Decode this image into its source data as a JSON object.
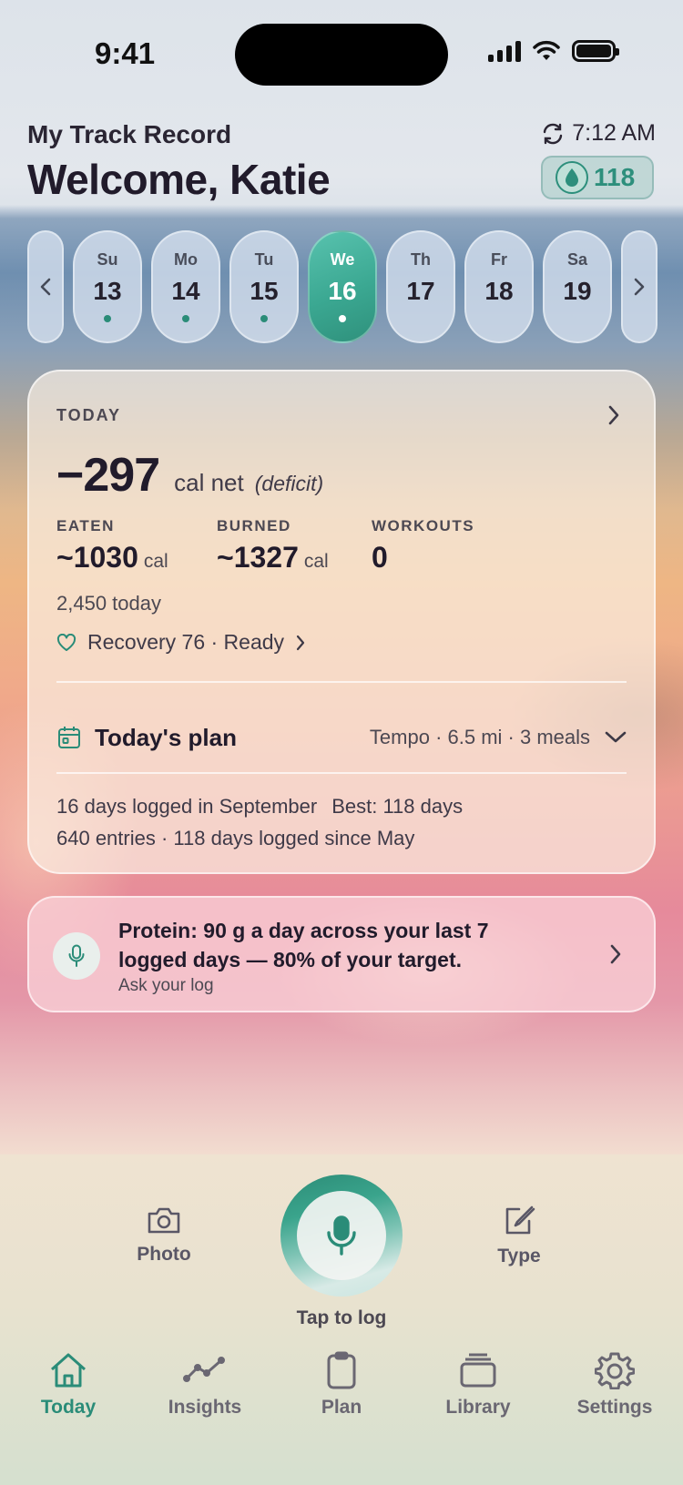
{
  "status_bar": {
    "time": "9:41"
  },
  "header": {
    "subtitle": "My Track Record",
    "title": "Welcome, Katie",
    "sync_time": "7:12 AM",
    "streak_count": "118"
  },
  "day_strip": {
    "days": [
      {
        "name": "Su",
        "date": "13",
        "logged": true,
        "selected": false
      },
      {
        "name": "Mo",
        "date": "14",
        "logged": true,
        "selected": false
      },
      {
        "name": "Tu",
        "date": "15",
        "logged": true,
        "selected": false
      },
      {
        "name": "We",
        "date": "16",
        "logged": true,
        "selected": true
      },
      {
        "name": "Th",
        "date": "17",
        "logged": false,
        "selected": false
      },
      {
        "name": "Fr",
        "date": "18",
        "logged": false,
        "selected": false
      },
      {
        "name": "Sa",
        "date": "19",
        "logged": false,
        "selected": false
      }
    ]
  },
  "summary": {
    "label": "TODAY",
    "net_value": "−297",
    "net_unit": "cal net",
    "net_note": "(deficit)",
    "eaten_label": "EATEN",
    "eaten_value": "~1030",
    "eaten_unit": "cal",
    "burned_label": "BURNED",
    "burned_value": "~1327",
    "burned_unit": "cal",
    "workouts_label": "WORKOUTS",
    "workouts_value": "0",
    "daily_total": "2,450 today",
    "recovery": "Recovery 76 · Ready",
    "plan_title": "Today's plan",
    "plan_summary": "Tempo · 6.5 mi · 3 meals",
    "logged_month": "16 days logged in September",
    "best": "Best: 118 days",
    "entries": "640 entries · 118 days logged since May"
  },
  "insight": {
    "text": "Protein: 90 g a day across your last 7 logged days — 80% of your target.",
    "subtitle": "Ask your log"
  },
  "actions": {
    "photo": "Photo",
    "type": "Type",
    "tap_to_log": "Tap to log"
  },
  "tabs": [
    {
      "label": "Today",
      "icon": "home-icon",
      "active": true
    },
    {
      "label": "Insights",
      "icon": "chart-line-icon",
      "active": false
    },
    {
      "label": "Plan",
      "icon": "clipboard-icon",
      "active": false
    },
    {
      "label": "Library",
      "icon": "stack-icon",
      "active": false
    },
    {
      "label": "Settings",
      "icon": "gear-icon",
      "active": false
    }
  ],
  "colors": {
    "accent": "#2a8c78",
    "text": "#211b2b"
  }
}
